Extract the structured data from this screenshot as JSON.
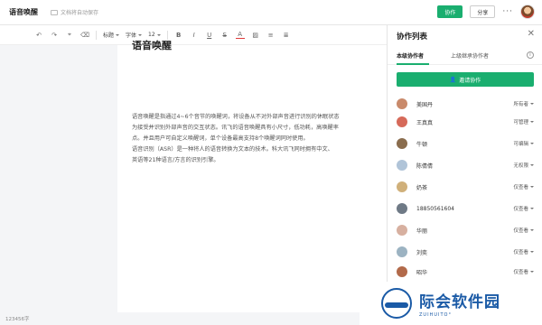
{
  "header": {
    "doc_title": "语音唤醒",
    "autosave": "文档将自动保存",
    "collab_label": "协作",
    "share_label": "分享",
    "more": "···"
  },
  "toolbar": {
    "undo": "↶",
    "redo": "↷",
    "format_painter": "⌖",
    "clear_format": "⌫",
    "heading_select": "标题",
    "font_select": "字体",
    "size_value": "12",
    "bold": "B",
    "italic": "I",
    "underline": "U",
    "strike": "S",
    "color": "A",
    "highlight": "▨",
    "list": "≡",
    "align": "≣"
  },
  "document": {
    "heading": "语音唤醒",
    "lines": [
      "语音唤醒是指通过4~6个音节的唤醒词，将设备从不对外部声音进行识别的休眠状态",
      "为接受并识别外部声音的交互状态。讯飞的语音唤醒具有小尺寸，低功耗，高唤醒率",
      "点。并且用户可自定义唤醒词，单个设备最高支持8个唤醒词同时使用。",
      "语音识别（ASR）是一种将人的语音转换为文本的技术。科大讯飞同时拥有中文、",
      "英语等21种语言/方言的识别引擎。"
    ]
  },
  "status": {
    "word_count": "123456字"
  },
  "panel": {
    "title": "协作列表",
    "close": "✕",
    "tab_current": "本级协作者",
    "tab_inherited": "上级继承协作者",
    "info": "i",
    "invite_label": "邀请协作",
    "members": [
      {
        "name": "美国丹",
        "role": "所有者",
        "color": "#c98a6b"
      },
      {
        "name": "王真真",
        "role": "可管理",
        "color": "#d66a5a"
      },
      {
        "name": "牛顿",
        "role": "可编辑",
        "color": "#8a6d4e"
      },
      {
        "name": "陈倩倩",
        "role": "无权限",
        "color": "#b0c4d8"
      },
      {
        "name": "奶茶",
        "role": "仅查看",
        "color": "#d0b07a"
      },
      {
        "name": "18850561604",
        "role": "仅查看",
        "color": "#6f7a86"
      },
      {
        "name": "华丽",
        "role": "仅查看",
        "color": "#d7b0a0"
      },
      {
        "name": "刘奕",
        "role": "仅查看",
        "color": "#9cb3c2"
      },
      {
        "name": "昭华",
        "role": "仅查看",
        "color": "#b26a4a"
      }
    ]
  },
  "watermark": {
    "cn": "际会软件园",
    "en": "ZUIHUITO°"
  }
}
